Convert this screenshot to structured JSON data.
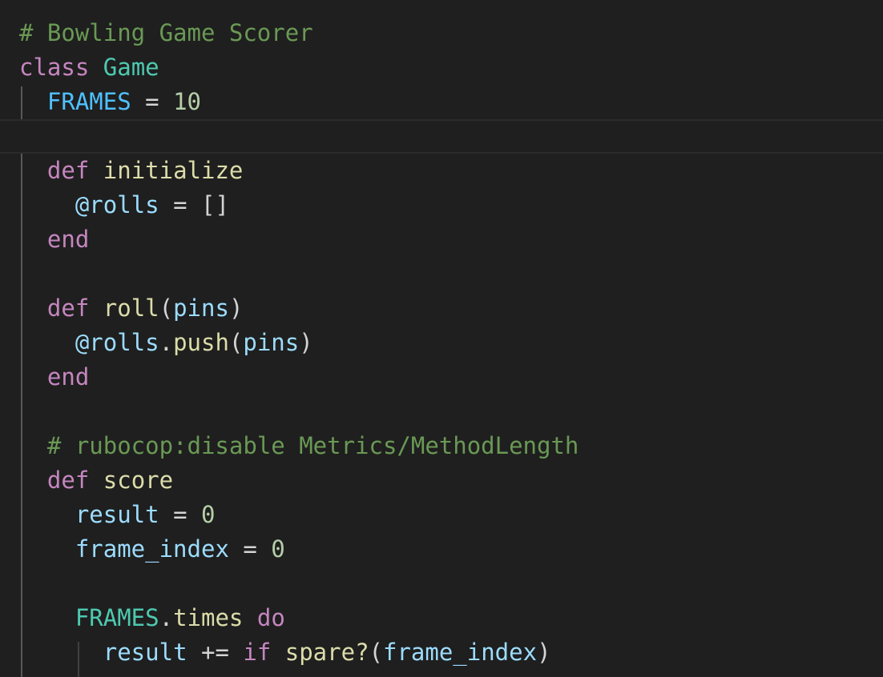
{
  "editor": {
    "colors": {
      "background": "#1f1f1f",
      "comment": "#6a9955",
      "keyword": "#c586c0",
      "class_name": "#4ec9b0",
      "constant": "#4fc1ff",
      "number": "#b5cea8",
      "function": "#dcdcaa",
      "variable": "#9cdcfe",
      "text": "#d4d4d4"
    },
    "lines": [
      {
        "tokens": [
          {
            "t": "# Bowling Game Scorer",
            "c": "comment"
          }
        ]
      },
      {
        "tokens": [
          {
            "t": "class",
            "c": "keyword"
          },
          {
            "t": " ",
            "c": "op"
          },
          {
            "t": "Game",
            "c": "class"
          }
        ]
      },
      {
        "tokens": [
          {
            "t": "  ",
            "c": "op"
          },
          {
            "t": "FRAMES",
            "c": "const"
          },
          {
            "t": " = ",
            "c": "op"
          },
          {
            "t": "10",
            "c": "number"
          }
        ]
      },
      {
        "tokens": [],
        "active": true
      },
      {
        "tokens": [
          {
            "t": "  ",
            "c": "op"
          },
          {
            "t": "def",
            "c": "keyword"
          },
          {
            "t": " ",
            "c": "op"
          },
          {
            "t": "initialize",
            "c": "func"
          }
        ]
      },
      {
        "tokens": [
          {
            "t": "    ",
            "c": "op"
          },
          {
            "t": "@rolls",
            "c": "ivar"
          },
          {
            "t": " = []",
            "c": "op"
          }
        ]
      },
      {
        "tokens": [
          {
            "t": "  ",
            "c": "op"
          },
          {
            "t": "end",
            "c": "keyword"
          }
        ]
      },
      {
        "tokens": []
      },
      {
        "tokens": [
          {
            "t": "  ",
            "c": "op"
          },
          {
            "t": "def",
            "c": "keyword"
          },
          {
            "t": " ",
            "c": "op"
          },
          {
            "t": "roll",
            "c": "func"
          },
          {
            "t": "(",
            "c": "punct"
          },
          {
            "t": "pins",
            "c": "var"
          },
          {
            "t": ")",
            "c": "punct"
          }
        ]
      },
      {
        "tokens": [
          {
            "t": "    ",
            "c": "op"
          },
          {
            "t": "@rolls",
            "c": "ivar"
          },
          {
            "t": ".",
            "c": "punct"
          },
          {
            "t": "push",
            "c": "func"
          },
          {
            "t": "(",
            "c": "punct"
          },
          {
            "t": "pins",
            "c": "var"
          },
          {
            "t": ")",
            "c": "punct"
          }
        ]
      },
      {
        "tokens": [
          {
            "t": "  ",
            "c": "op"
          },
          {
            "t": "end",
            "c": "keyword"
          }
        ]
      },
      {
        "tokens": []
      },
      {
        "tokens": [
          {
            "t": "  ",
            "c": "op"
          },
          {
            "t": "# rubocop:disable Metrics/MethodLength",
            "c": "comment"
          }
        ]
      },
      {
        "tokens": [
          {
            "t": "  ",
            "c": "op"
          },
          {
            "t": "def",
            "c": "keyword"
          },
          {
            "t": " ",
            "c": "op"
          },
          {
            "t": "score",
            "c": "func"
          }
        ]
      },
      {
        "tokens": [
          {
            "t": "    ",
            "c": "op"
          },
          {
            "t": "result",
            "c": "var"
          },
          {
            "t": " = ",
            "c": "op"
          },
          {
            "t": "0",
            "c": "number"
          }
        ]
      },
      {
        "tokens": [
          {
            "t": "    ",
            "c": "op"
          },
          {
            "t": "frame_index",
            "c": "var"
          },
          {
            "t": " = ",
            "c": "op"
          },
          {
            "t": "0",
            "c": "number"
          }
        ]
      },
      {
        "tokens": []
      },
      {
        "tokens": [
          {
            "t": "    ",
            "c": "op"
          },
          {
            "t": "FRAMES",
            "c": "const-type"
          },
          {
            "t": ".",
            "c": "punct"
          },
          {
            "t": "times",
            "c": "func"
          },
          {
            "t": " ",
            "c": "op"
          },
          {
            "t": "do",
            "c": "keyword"
          }
        ]
      },
      {
        "tokens": [
          {
            "t": "      ",
            "c": "op"
          },
          {
            "t": "result",
            "c": "var"
          },
          {
            "t": " += ",
            "c": "op"
          },
          {
            "t": "if",
            "c": "keyword"
          },
          {
            "t": " ",
            "c": "op"
          },
          {
            "t": "spare?",
            "c": "func"
          },
          {
            "t": "(",
            "c": "punct"
          },
          {
            "t": "frame_index",
            "c": "var"
          },
          {
            "t": ")",
            "c": "punct"
          }
        ]
      }
    ]
  }
}
